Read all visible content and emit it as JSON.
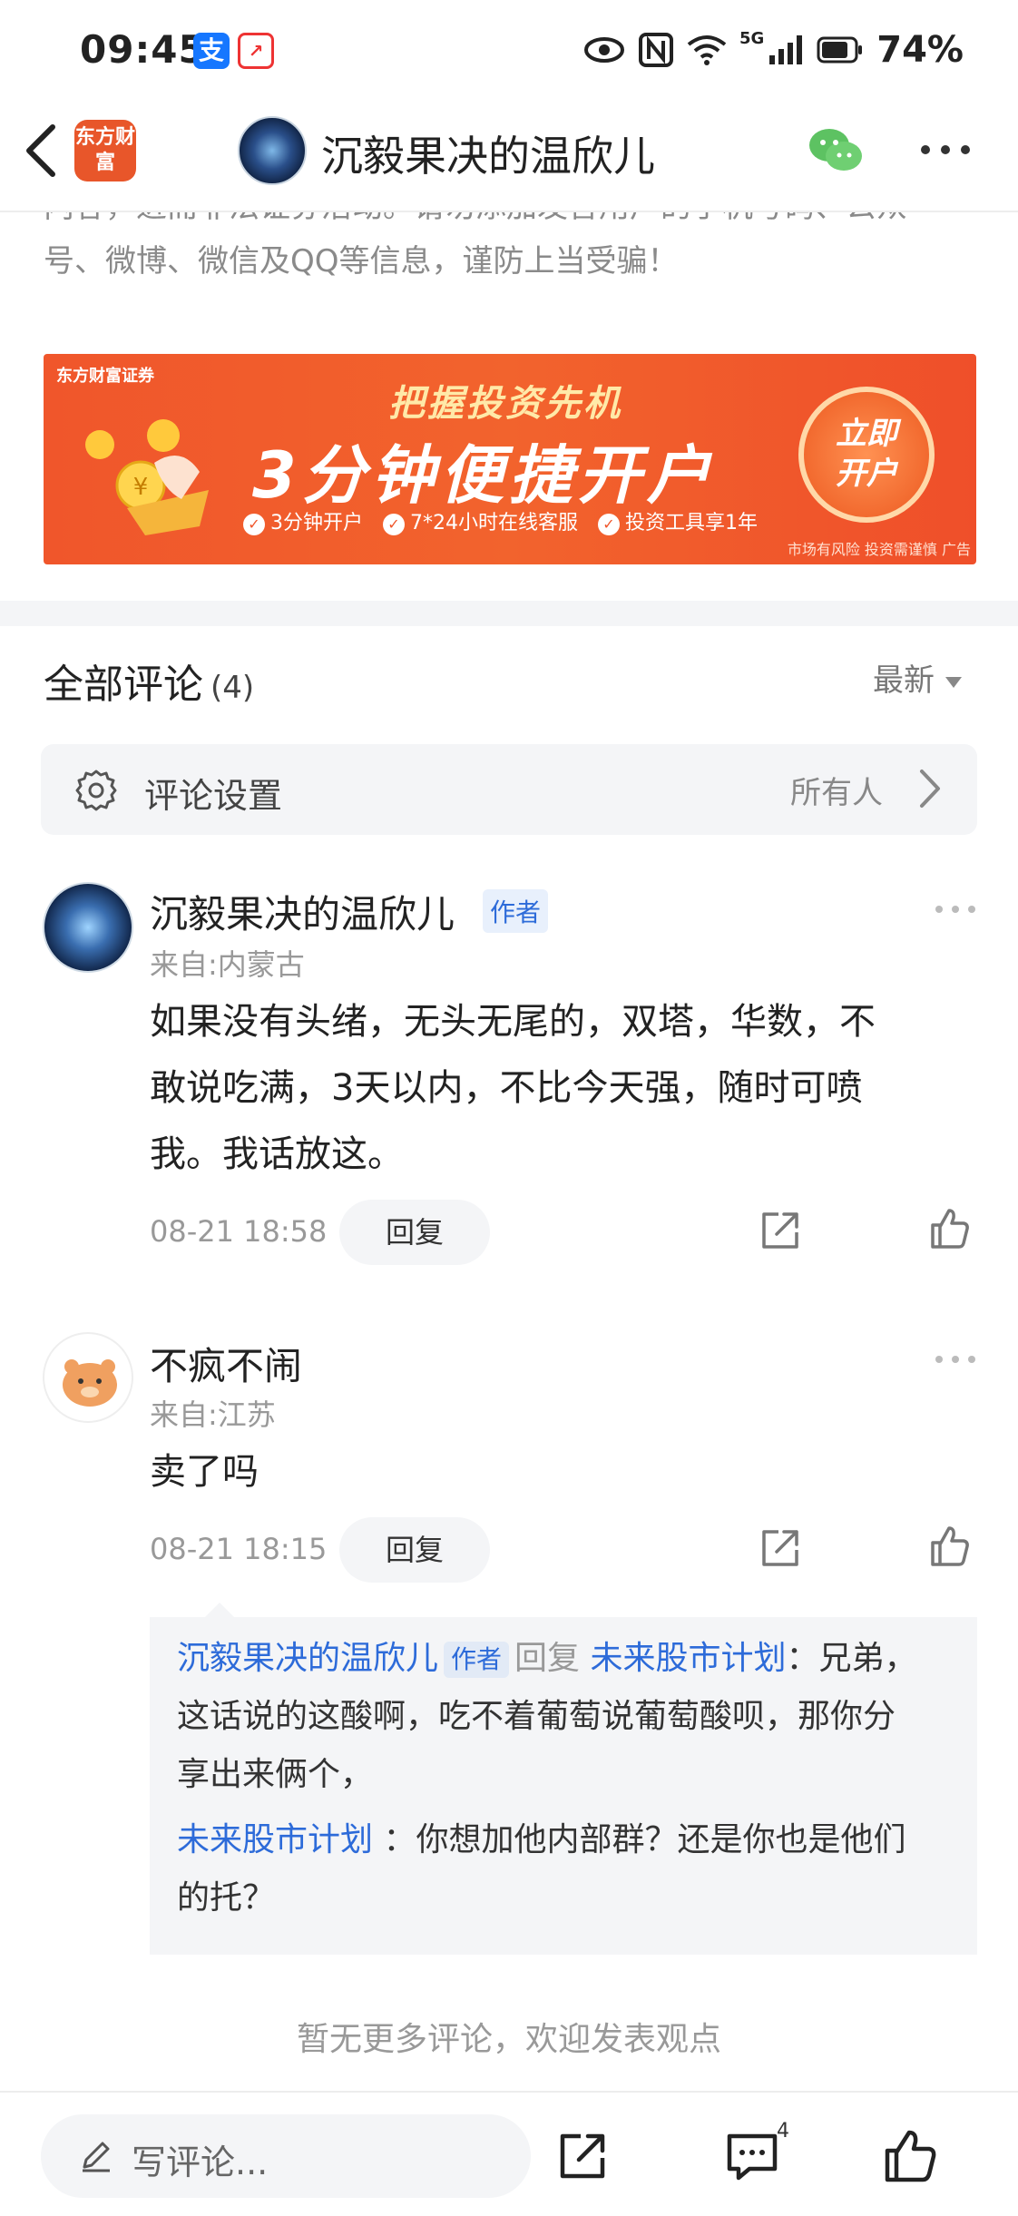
{
  "status_bar": {
    "time": "09:45",
    "app_icon_1": "支",
    "network": "5G",
    "battery": "74%"
  },
  "nav": {
    "logo_text": "东方财富",
    "title": "沉毅果决的温欣儿"
  },
  "notice": {
    "line1": "内容，进而非法证券活动。请勿添加发言用户的手机号码、公众",
    "line2": "号、微博、微信及QQ等信息，谨防上当受骗！"
  },
  "banner": {
    "brand": "东方财富证券",
    "headline": "把握投资先机",
    "main": "3分钟便捷开户",
    "features": [
      "3分钟开户",
      "7*24小时在线客服",
      "投资工具享1年"
    ],
    "cta": "立即开户",
    "disclaimer": "市场有风险 投资需谨慎 广告"
  },
  "comments_header": {
    "title": "全部评论",
    "count": "(4)",
    "sort": "最新"
  },
  "settings": {
    "label": "评论设置",
    "value": "所有人"
  },
  "comments": [
    {
      "username": "沉毅果决的温欣儿",
      "tag": "作者",
      "location": "来自:内蒙古",
      "lines": [
        "如果没有头绪，无头无尾的，双塔，华数，不",
        "敢说吃满，3天以内，不比今天强，随时可喷",
        "我。我话放这。"
      ],
      "time": "08-21 18:58",
      "reply_label": "回复"
    },
    {
      "username": "不疯不闹",
      "location": "来自:江苏",
      "lines": [
        "卖了吗"
      ],
      "time": "08-21 18:15",
      "reply_label": "回复"
    }
  ],
  "replies": [
    {
      "from": "沉毅果决的温欣儿",
      "tag": "作者",
      "verb": "回复",
      "to": "未来股市计划",
      "text_1": "：兄弟，",
      "text_2": "这话说的这酸啊，吃不着葡萄说葡萄酸呗，那你分",
      "text_3": "享出来俩个，"
    },
    {
      "from": "未来股市计划",
      "text_1": "：你想加他内部群？还是你也是他们",
      "text_2": "的托？"
    }
  ],
  "no_more": "暂无更多评论，欢迎发表观点",
  "bottom_bar": {
    "placeholder": "写评论...",
    "comment_count": "4"
  }
}
